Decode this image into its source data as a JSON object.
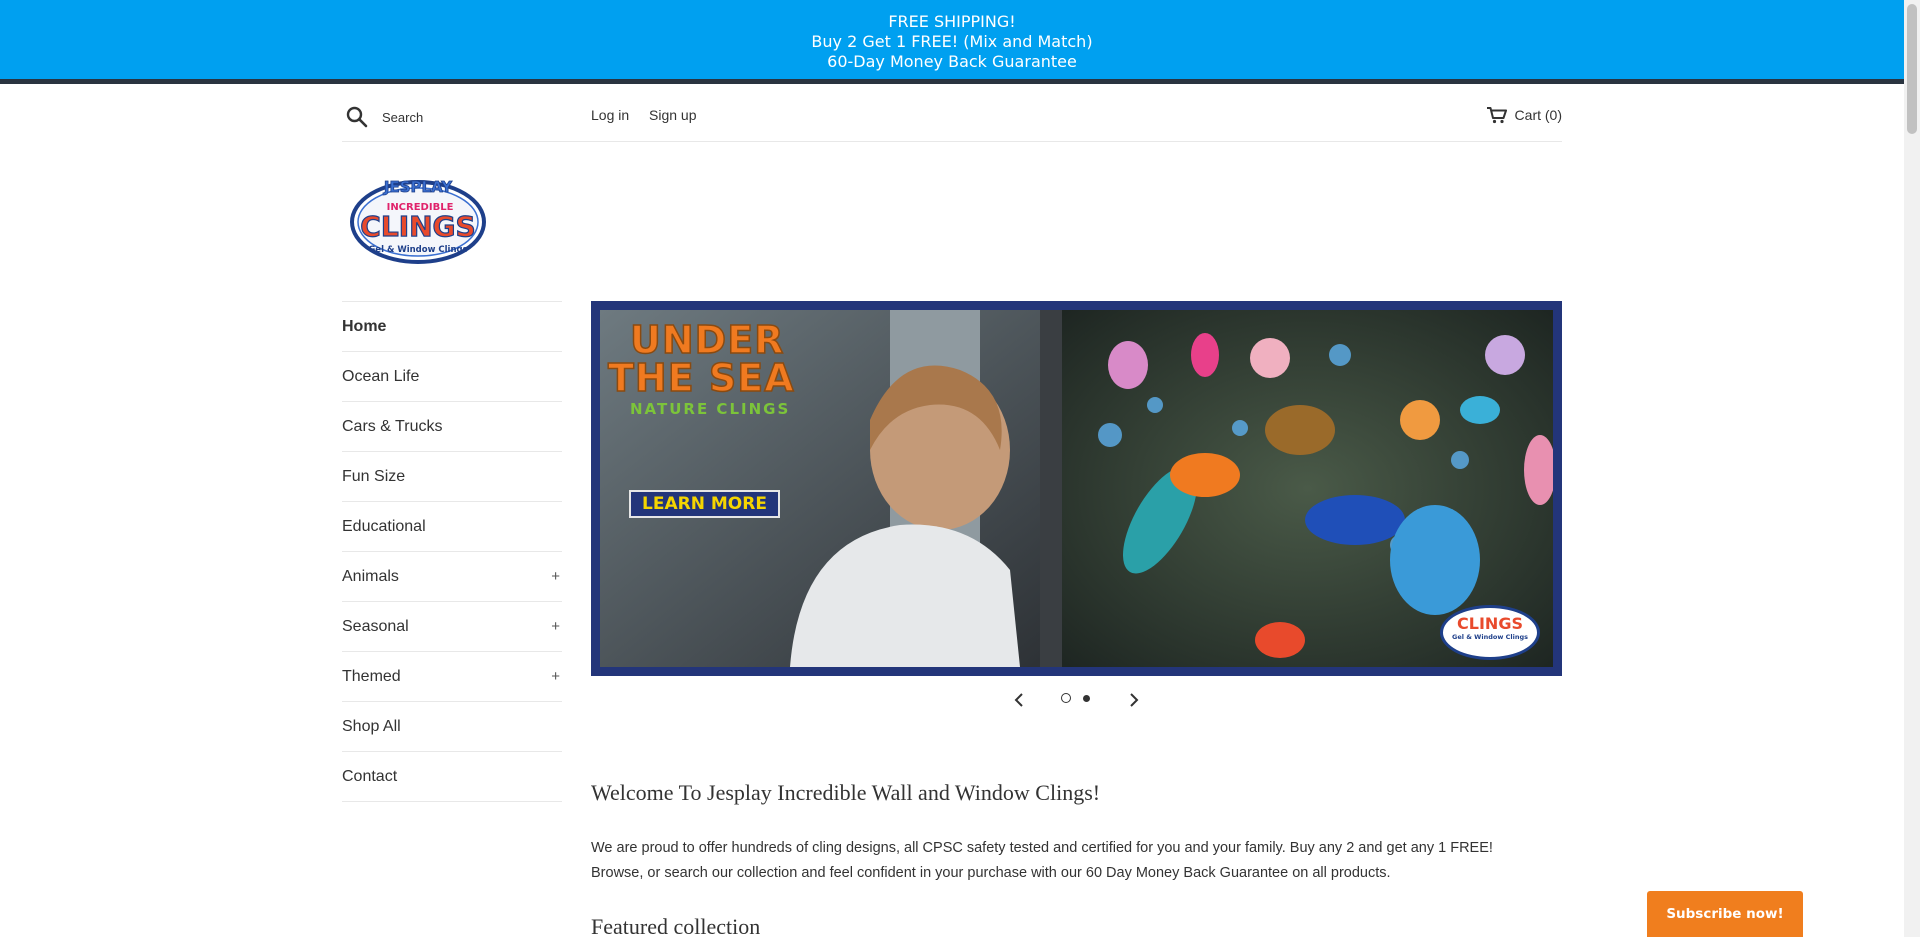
{
  "announcement": {
    "line1": "FREE SHIPPING!",
    "line2": "Buy 2 Get 1 FREE! (Mix and Match)",
    "line3": "60-Day Money Back Guarantee",
    "bg_color": "#00a0f0"
  },
  "header": {
    "search_placeholder": "Search",
    "login_label": "Log in",
    "signup_label": "Sign up",
    "cart_label": "Cart (0)"
  },
  "logo": {
    "top_text": "JESPLAY",
    "mid_text": "INCREDIBLE",
    "main_text": "CLINGS",
    "sub_text": "Gel & Window Clings"
  },
  "sidebar": {
    "items": [
      {
        "label": "Home",
        "expandable": false,
        "active": true
      },
      {
        "label": "Ocean Life",
        "expandable": false
      },
      {
        "label": "Cars & Trucks",
        "expandable": false
      },
      {
        "label": "Fun Size",
        "expandable": false
      },
      {
        "label": "Educational",
        "expandable": false
      },
      {
        "label": "Animals",
        "expandable": true
      },
      {
        "label": "Seasonal",
        "expandable": true
      },
      {
        "label": "Themed",
        "expandable": true
      },
      {
        "label": "Shop All",
        "expandable": false
      },
      {
        "label": "Contact",
        "expandable": false
      }
    ],
    "expand_symbol": "+"
  },
  "slideshow": {
    "title_line1": "UNDER",
    "title_line2": "THE SEA",
    "subtitle": "NATURE CLINGS",
    "cta_label": "LEARN MORE",
    "logo_text": "CLINGS",
    "logo_sub": "Gel & Window Clings",
    "slide_count": 2,
    "active_slide": 1
  },
  "main": {
    "welcome_title": "Welcome To Jesplay Incredible Wall and Window Clings!",
    "intro_line1": "We are proud to offer hundreds of cling designs, all CPSC safety tested and certified for you and your family. Buy any 2 and get any 1 FREE!",
    "intro_line2": "Browse, or search our collection and feel confident in your purchase with our 60 Day Money Back Guarantee on all products.",
    "featured_title": "Featured collection"
  },
  "subscribe": {
    "label": "Subscribe now!",
    "color": "#f07e1e"
  }
}
